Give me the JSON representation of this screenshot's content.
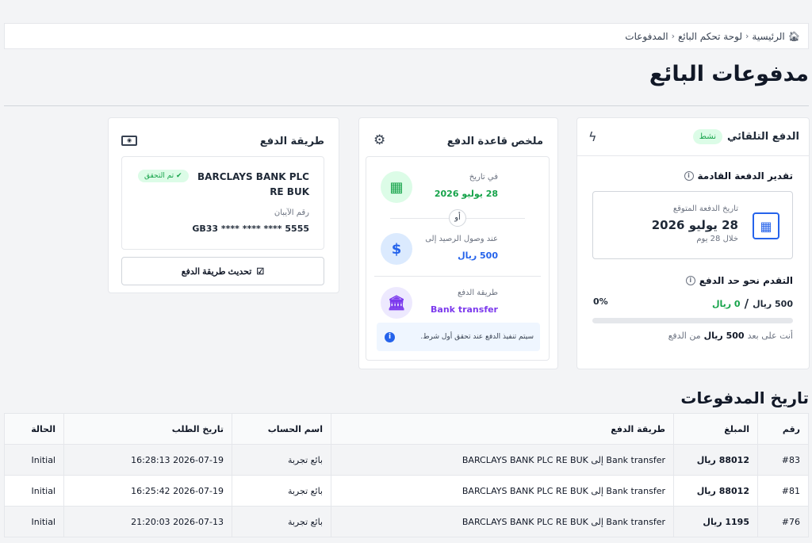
{
  "breadcrumb": {
    "home": "الرئيسية",
    "dashboard": "لوحة تحكم البائع",
    "current": "المدفوعات",
    "sep": "‹"
  },
  "page_title": "مدفوعات البائع",
  "auto_payout": {
    "title": "الدفع التلقائي",
    "status": "نشط",
    "next_estimate_title": "تقدير الدفعة القادمة",
    "expected_date_label": "تاريخ الدفعة المتوقع",
    "expected_date": "28 يوليو 2026",
    "within": "خلال 28 يوم",
    "progress_title": "التقدم نحو حد الدفع",
    "progress_current": "0 ريال",
    "progress_sep": "/",
    "progress_target": "500 ريال",
    "progress_percent": "0%",
    "progress_value": 0,
    "remaining_prefix": "أنت على بعد",
    "remaining_amount": "500 ريال",
    "remaining_suffix": "من الدفع"
  },
  "rule_summary": {
    "title": "ملخص قاعدة الدفع",
    "date_label": "في تاريخ",
    "date_value": "28 يوليو 2026",
    "or_label": "أو",
    "balance_label": "عند وصول الرصيد إلى",
    "balance_value": "500 ريال",
    "method_label": "طريقة الدفع",
    "method_value": "Bank transfer",
    "note": "سيتم تنفيذ الدفع عند تحقق أول شرط."
  },
  "payment_method": {
    "title": "طريقة الدفع",
    "bank_name": "BARCLAYS BANK PLC RE BUK",
    "verified": "تم التحقق",
    "iban_label": "رقم الآيبان",
    "iban": "GB33 **** **** **** 5555",
    "update_button": "تحديث طريقة الدفع"
  },
  "history": {
    "title": "تاريخ المدفوعات",
    "columns": [
      "رقم",
      "المبلغ",
      "طريقة الدفع",
      "اسم الحساب",
      "تاريخ الطلب",
      "الحالة"
    ],
    "rows": [
      {
        "id": "#83",
        "amount": "88012 ريال",
        "method": "Bank transfer إلى BARCLAYS BANK PLC RE BUK",
        "account": "بائع تجربة",
        "date": "2026-07-19 16:28:13",
        "status": "Initial"
      },
      {
        "id": "#81",
        "amount": "88012 ريال",
        "method": "Bank transfer إلى BARCLAYS BANK PLC RE BUK",
        "account": "بائع تجربة",
        "date": "2026-07-19 16:25:42",
        "status": "Initial"
      },
      {
        "id": "#76",
        "amount": "1195 ريال",
        "method": "Bank transfer إلى BARCLAYS BANK PLC RE BUK",
        "account": "بائع تجربة",
        "date": "2026-07-13 21:20:03",
        "status": "Initial"
      }
    ]
  },
  "colors": {
    "accent": "#2563eb",
    "success": "#16a34a",
    "purple": "#7c3aed"
  }
}
